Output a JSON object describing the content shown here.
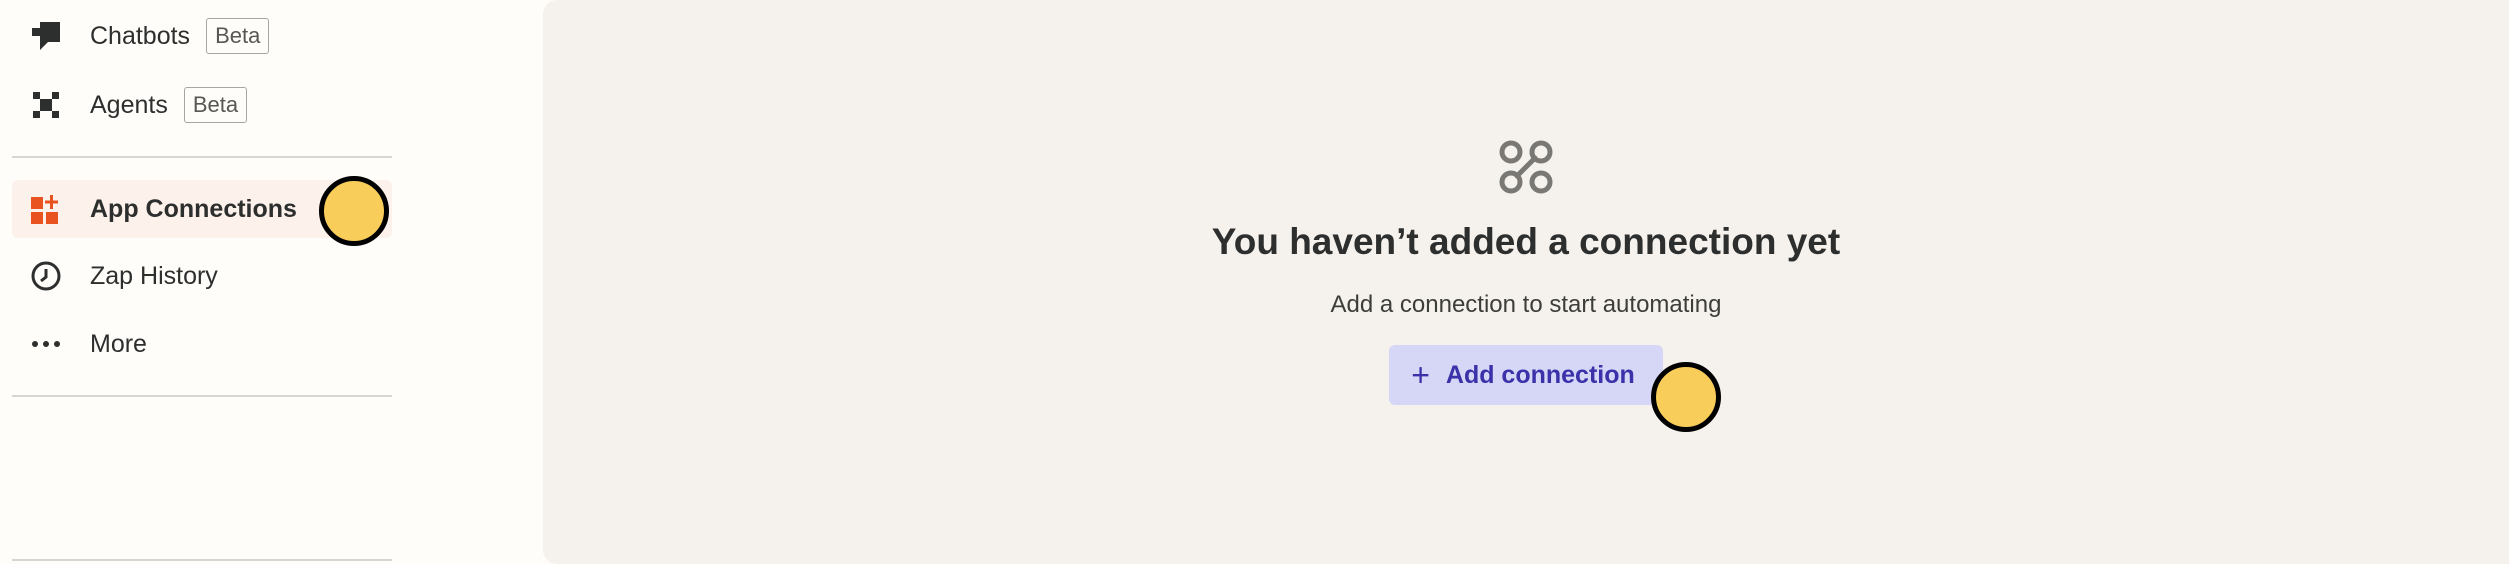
{
  "sidebar": {
    "items": [
      {
        "label": "Chatbots",
        "badge": "Beta",
        "icon": "chatbot-icon"
      },
      {
        "label": "Agents",
        "badge": "Beta",
        "icon": "agents-icon"
      },
      {
        "label": "App Connections",
        "icon": "app-connections-icon",
        "active": true
      },
      {
        "label": "Zap History",
        "icon": "clock-icon"
      },
      {
        "label": "More",
        "icon": "more-dots-icon"
      }
    ]
  },
  "main": {
    "empty_icon": "connections-icon",
    "title": "You haven’t added a connection yet",
    "subtitle": "Add a connection to start automating",
    "add_button_label": "Add connection"
  },
  "colors": {
    "accent_orange": "#e8531f",
    "button_bg": "#d6d7f7",
    "button_text": "#3b31a8",
    "marker": "#f8cd5a",
    "main_bg": "#f5f2ed"
  }
}
